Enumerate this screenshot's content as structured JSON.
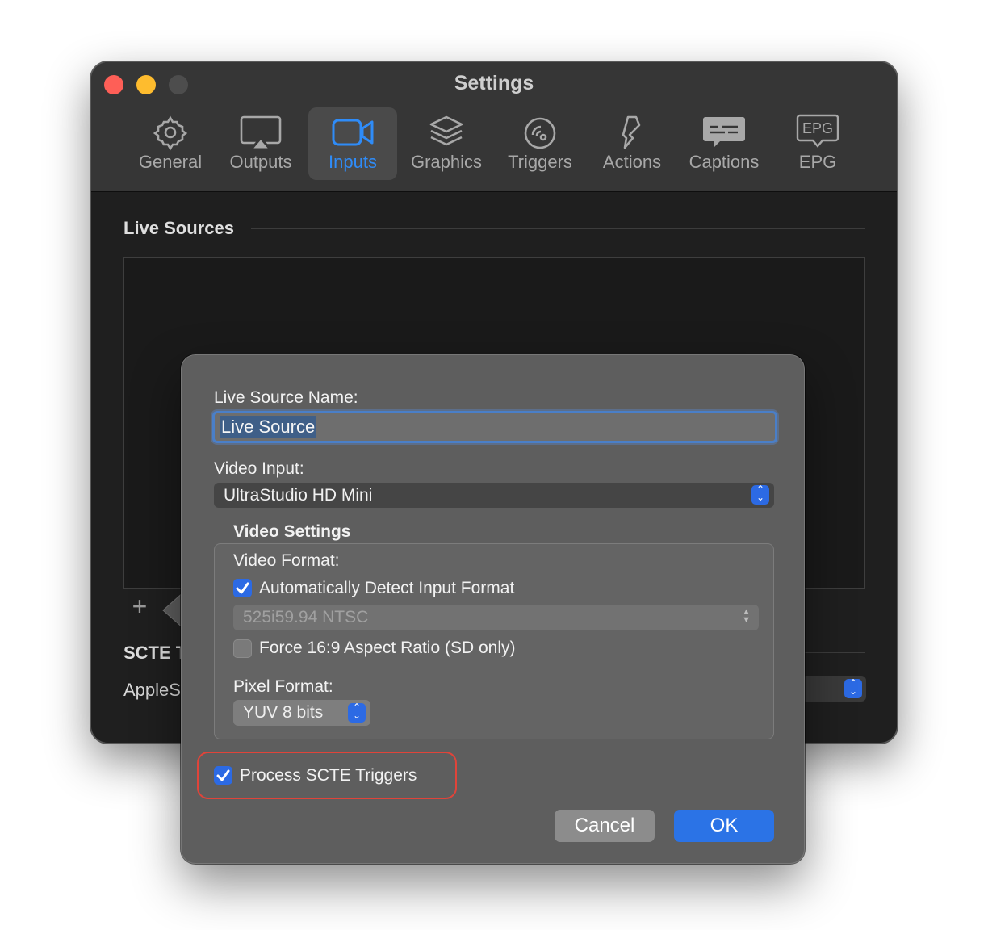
{
  "window": {
    "title": "Settings",
    "tabs": [
      {
        "label": "General",
        "icon": "gear-icon",
        "active": false
      },
      {
        "label": "Outputs",
        "icon": "airplay-icon",
        "active": false
      },
      {
        "label": "Inputs",
        "icon": "video-camera-icon",
        "active": true
      },
      {
        "label": "Graphics",
        "icon": "layers-icon",
        "active": false
      },
      {
        "label": "Triggers",
        "icon": "trigger-icon",
        "active": false
      },
      {
        "label": "Actions",
        "icon": "actions-icon",
        "active": false
      },
      {
        "label": "Captions",
        "icon": "captions-icon",
        "active": false
      },
      {
        "label": "EPG",
        "icon": "epg-icon",
        "active": false
      }
    ],
    "epg_icon_text": "EPG"
  },
  "main": {
    "live_sources_title": "Live Sources",
    "add_label": "+",
    "scte_title_partial": "SCTE T",
    "apple_partial": "AppleS"
  },
  "sheet": {
    "name_label": "Live Source Name:",
    "name_value": "Live Source",
    "video_input_label": "Video Input:",
    "video_input_value": "UltraStudio HD Mini",
    "video_settings_title": "Video Settings",
    "video_format_label": "Video Format:",
    "auto_detect_label": "Automatically Detect Input Format",
    "auto_detect_checked": true,
    "format_value": "525i59.94 NTSC",
    "force_aspect_label": "Force 16:9 Aspect Ratio (SD only)",
    "force_aspect_checked": false,
    "pixel_format_label": "Pixel Format:",
    "pixel_format_value": "YUV 8 bits",
    "process_scte_label": "Process SCTE Triggers",
    "process_scte_checked": true,
    "cancel_label": "Cancel",
    "ok_label": "OK"
  },
  "colors": {
    "accent": "#2c6ae4",
    "highlight_ring": "#e0443a",
    "active_tab_text": "#2f8cf8"
  }
}
